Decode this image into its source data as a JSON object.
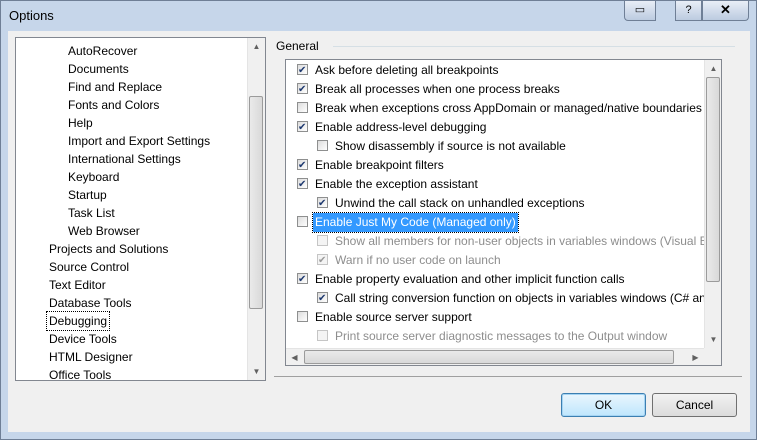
{
  "window": {
    "title": "Options",
    "close_glyph": "✕",
    "help_glyph": "?",
    "restore_glyph": "▭"
  },
  "tree": {
    "items": [
      {
        "label": "AutoRecover",
        "level": 2
      },
      {
        "label": "Documents",
        "level": 2
      },
      {
        "label": "Find and Replace",
        "level": 2
      },
      {
        "label": "Fonts and Colors",
        "level": 2
      },
      {
        "label": "Help",
        "level": 2
      },
      {
        "label": "Import and Export Settings",
        "level": 2
      },
      {
        "label": "International Settings",
        "level": 2
      },
      {
        "label": "Keyboard",
        "level": 2
      },
      {
        "label": "Startup",
        "level": 2
      },
      {
        "label": "Task List",
        "level": 2
      },
      {
        "label": "Web Browser",
        "level": 2
      },
      {
        "label": "Projects and Solutions",
        "level": 1
      },
      {
        "label": "Source Control",
        "level": 1
      },
      {
        "label": "Text Editor",
        "level": 1
      },
      {
        "label": "Database Tools",
        "level": 1
      },
      {
        "label": "Debugging",
        "level": 1,
        "selected": true
      },
      {
        "label": "Device Tools",
        "level": 1
      },
      {
        "label": "HTML Designer",
        "level": 1
      },
      {
        "label": "Office Tools",
        "level": 1
      }
    ]
  },
  "group": {
    "label": "General"
  },
  "options": [
    {
      "label": "Ask before deleting all breakpoints",
      "checked": true,
      "indent": 0
    },
    {
      "label": "Break all processes when one process breaks",
      "checked": true,
      "indent": 0
    },
    {
      "label": "Break when exceptions cross AppDomain or managed/native boundaries (Managed only)",
      "checked": false,
      "indent": 0
    },
    {
      "label": "Enable address-level debugging",
      "checked": true,
      "indent": 0
    },
    {
      "label": "Show disassembly if source is not available",
      "checked": false,
      "indent": 1
    },
    {
      "label": "Enable breakpoint filters",
      "checked": true,
      "indent": 0
    },
    {
      "label": "Enable the exception assistant",
      "checked": true,
      "indent": 0
    },
    {
      "label": "Unwind the call stack on unhandled exceptions",
      "checked": true,
      "indent": 1
    },
    {
      "label": "Enable Just My Code (Managed only)",
      "checked": false,
      "indent": 0,
      "highlight": true
    },
    {
      "label": "Show all members for non-user objects in variables windows (Visual Basic only)",
      "checked": false,
      "indent": 1,
      "disabled": true
    },
    {
      "label": "Warn if no user code on launch",
      "checked": true,
      "indent": 1,
      "disabled": true
    },
    {
      "label": "Enable property evaluation and other implicit function calls",
      "checked": true,
      "indent": 0
    },
    {
      "label": "Call string conversion function on objects in variables windows (C# and JavaScript only)",
      "checked": true,
      "indent": 1
    },
    {
      "label": "Enable source server support",
      "checked": false,
      "indent": 0
    },
    {
      "label": "Print source server diagnostic messages to the Output window",
      "checked": false,
      "indent": 1,
      "disabled": true
    }
  ],
  "buttons": {
    "ok": "OK",
    "cancel": "Cancel"
  },
  "scroll": {
    "up_glyph": "▲",
    "down_glyph": "▼",
    "left_glyph": "◀",
    "right_glyph": "▶"
  },
  "colors": {
    "selection": "#3399ff",
    "window_frame": "#c6d6ea"
  }
}
